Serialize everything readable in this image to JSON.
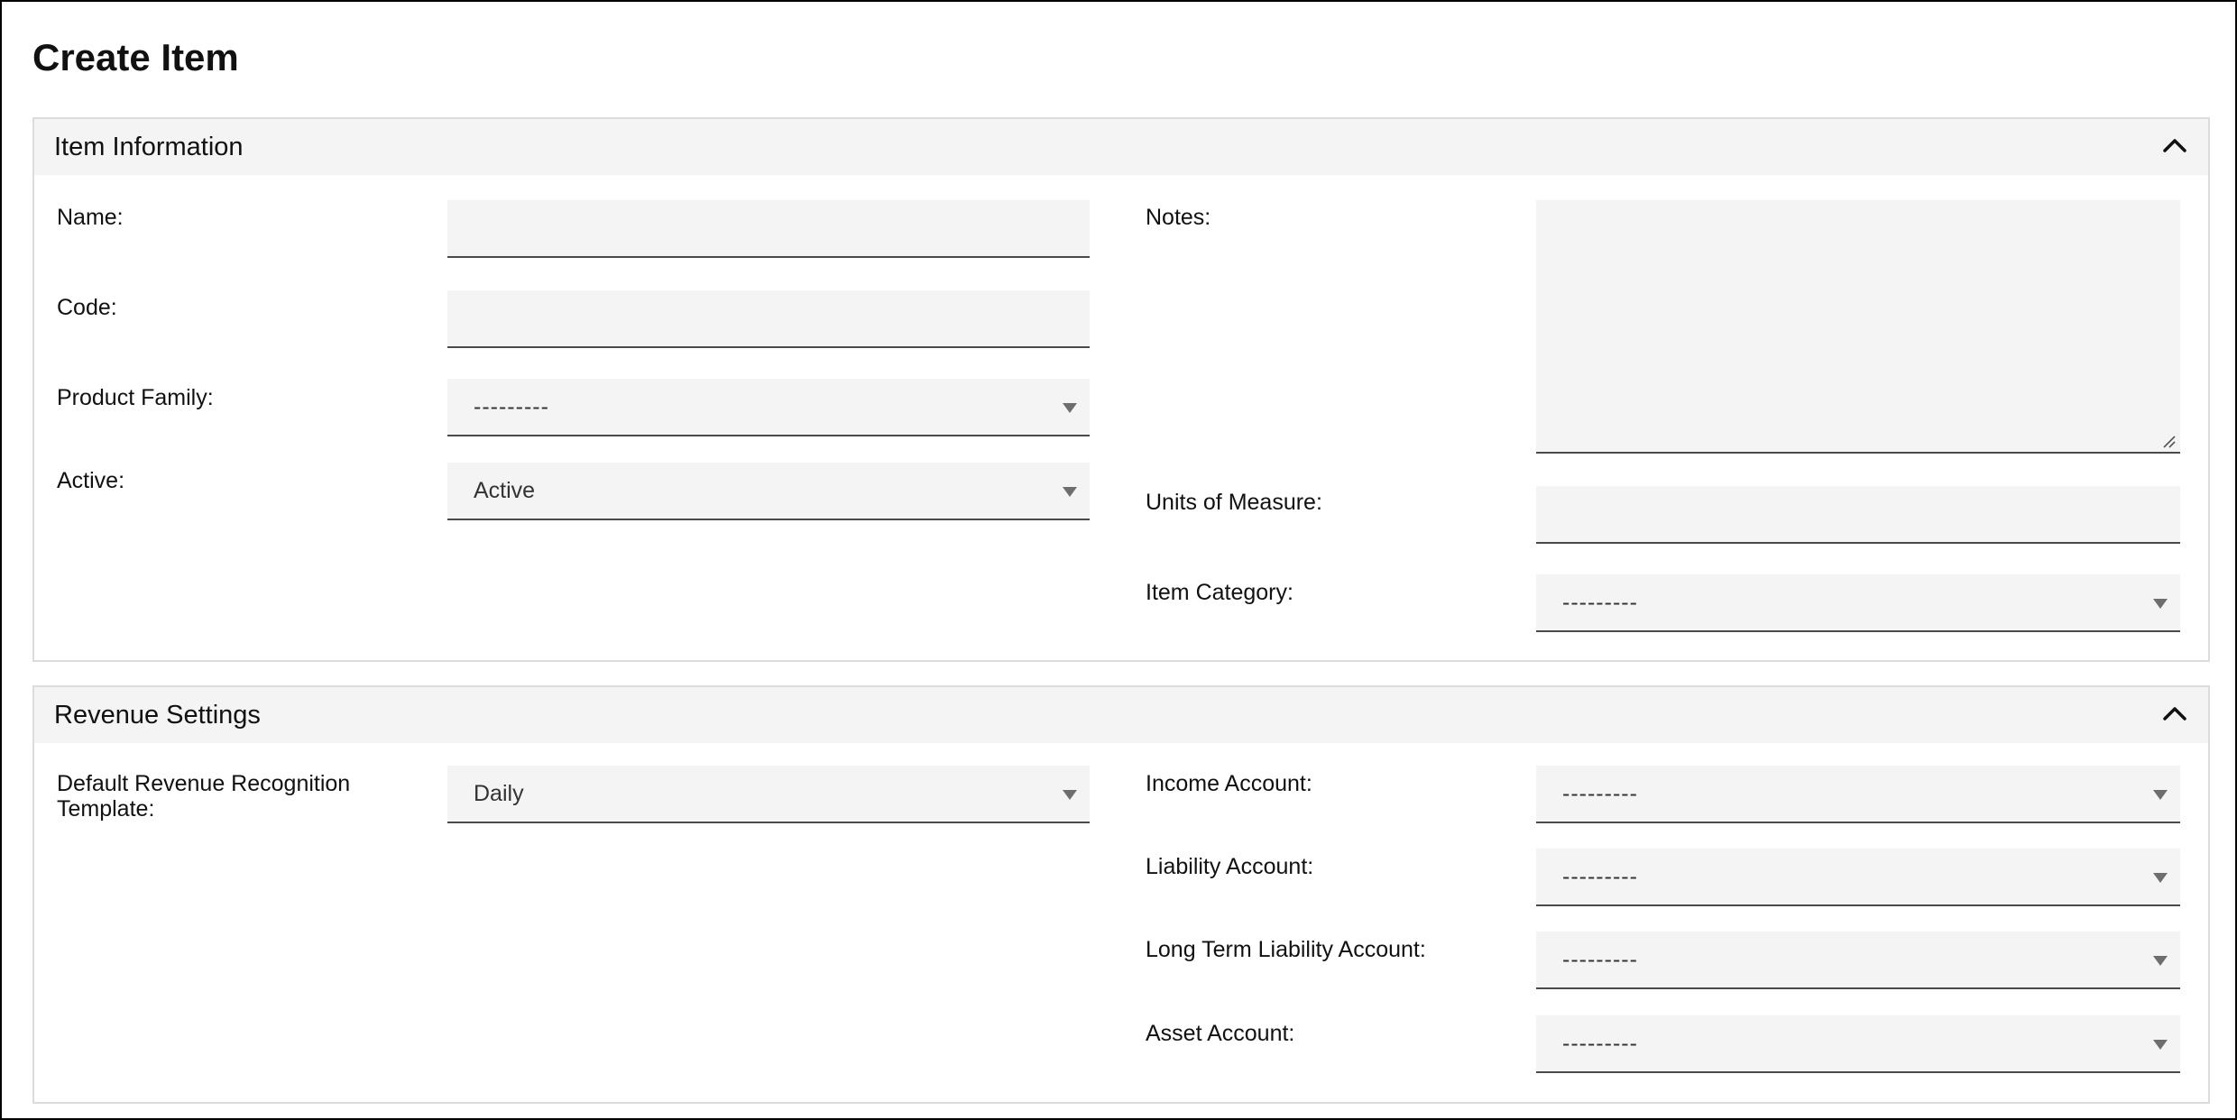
{
  "page": {
    "title": "Create Item"
  },
  "item_information": {
    "title": "Item Information",
    "name": {
      "label": "Name:",
      "value": ""
    },
    "code": {
      "label": "Code:",
      "value": ""
    },
    "product_family": {
      "label": "Product Family:",
      "value": "---------"
    },
    "active": {
      "label": "Active:",
      "value": "Active"
    },
    "notes": {
      "label": "Notes:",
      "value": ""
    },
    "units_of_measure": {
      "label": "Units of Measure:",
      "value": ""
    },
    "item_category": {
      "label": "Item Category:",
      "value": "---------"
    }
  },
  "revenue_settings": {
    "title": "Revenue Settings",
    "default_template": {
      "label_line1": "Default Revenue Recognition",
      "label_line2": "Template:",
      "value": "Daily"
    },
    "income_account": {
      "label": "Income Account:",
      "value": "---------"
    },
    "liability_account": {
      "label": "Liability Account:",
      "value": "---------"
    },
    "long_term_liability_account": {
      "label": "Long Term Liability Account:",
      "value": "---------"
    },
    "asset_account": {
      "label": "Asset Account:",
      "value": "---------"
    }
  },
  "icons": {
    "collapse": "chevron-up-icon",
    "dropdown": "caret-down-icon",
    "resize": "resize-grip-icon"
  },
  "colors": {
    "header_bg": "#f4f4f4",
    "field_bg": "#f4f4f4",
    "field_underline": "#4a4a4a",
    "panel_border": "#dcdcdc"
  }
}
